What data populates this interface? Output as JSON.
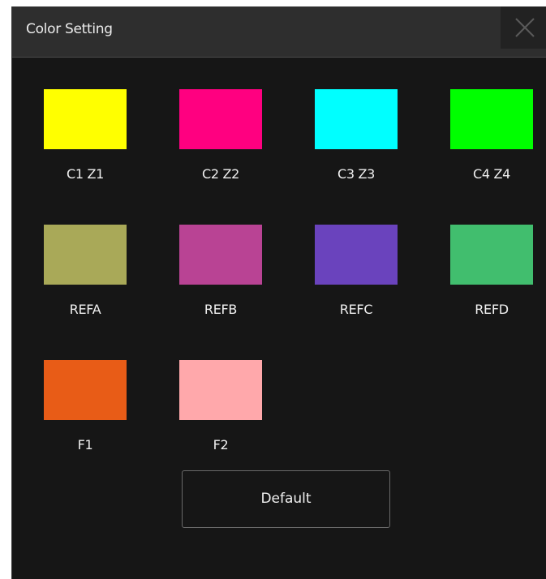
{
  "dialog": {
    "title": "Color Setting",
    "close_icon": "close-icon"
  },
  "swatches": [
    {
      "label": "C1 Z1",
      "color": "#ffff00"
    },
    {
      "label": "C2 Z2",
      "color": "#ff0080"
    },
    {
      "label": "C3 Z3",
      "color": "#00ffff"
    },
    {
      "label": "C4 Z4",
      "color": "#00ff00"
    },
    {
      "label": "REFA",
      "color": "#a9a958"
    },
    {
      "label": "REFB",
      "color": "#b94394"
    },
    {
      "label": "REFC",
      "color": "#6a43bd"
    },
    {
      "label": "REFD",
      "color": "#41be6e"
    },
    {
      "label": "F1",
      "color": "#e85c17"
    },
    {
      "label": "F2",
      "color": "#ffa8ab"
    }
  ],
  "default_button": {
    "label": "Default"
  }
}
